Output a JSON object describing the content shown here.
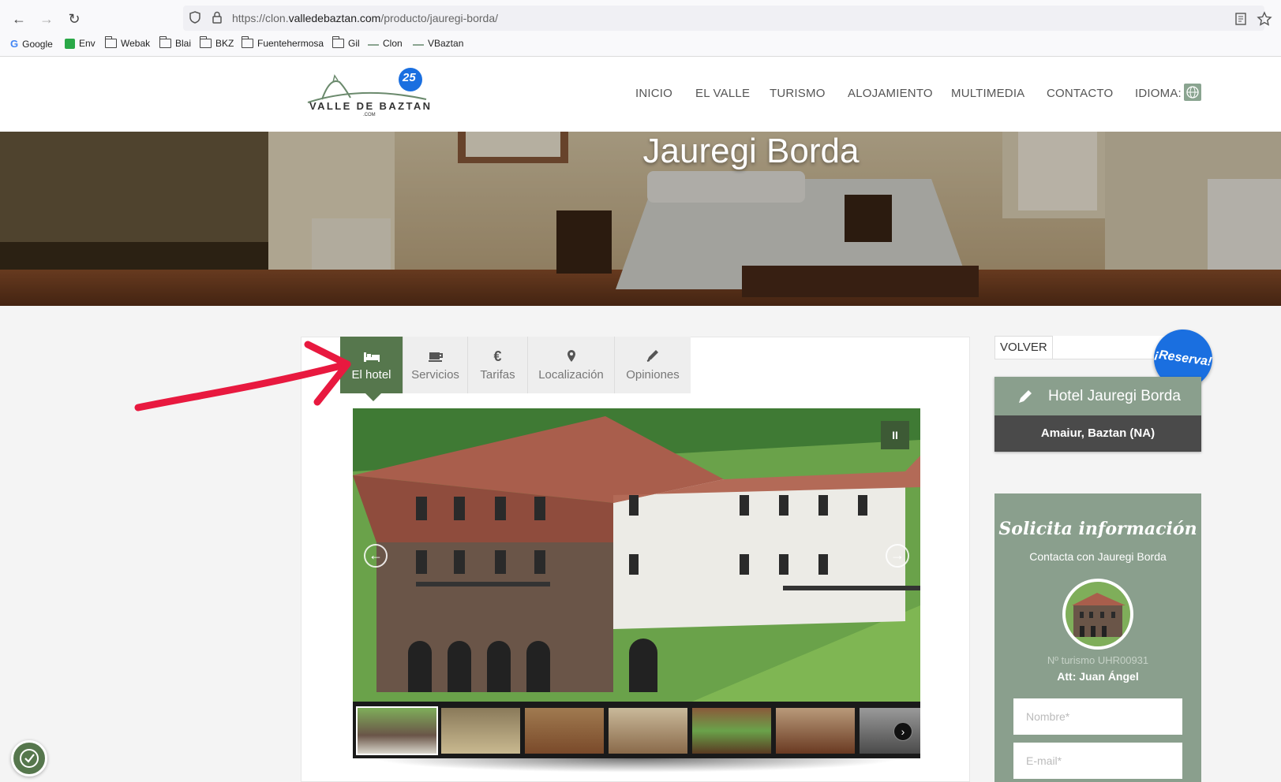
{
  "browser": {
    "url_prefix": "https://clon.",
    "url_domain": "valledebaztan.com",
    "url_path": "/producto/jauregi-borda/",
    "bookmarks": [
      {
        "label": "Google",
        "icon": "google-icon"
      },
      {
        "label": "Env",
        "icon": "env-icon"
      },
      {
        "label": "Webak",
        "icon": "folder-icon"
      },
      {
        "label": "Blai",
        "icon": "folder-icon"
      },
      {
        "label": "BKZ",
        "icon": "folder-icon"
      },
      {
        "label": "Fuentehermosa",
        "icon": "folder-icon"
      },
      {
        "label": "Gil",
        "icon": "folder-icon"
      },
      {
        "label": "Clon",
        "icon": "site-icon"
      },
      {
        "label": "VBaztan",
        "icon": "site-icon"
      }
    ]
  },
  "site": {
    "logo_text": "VALLE DE BAZTAN",
    "logo_sub": ".COM",
    "logo_badge": "25",
    "nav": [
      "INICIO",
      "EL VALLE",
      "TURISMO",
      "ALOJAMIENTO",
      "MULTIMEDIA",
      "CONTACTO",
      "IDIOMA:"
    ]
  },
  "hero": {
    "title": "Jauregi Borda"
  },
  "tabs": [
    {
      "label": "El hotel",
      "icon": "bed-icon",
      "active": true
    },
    {
      "label": "Servicios",
      "icon": "coffee-icon",
      "active": false
    },
    {
      "label": "Tarifas",
      "icon": "euro-icon",
      "active": false
    },
    {
      "label": "Localización",
      "icon": "map-marker-icon",
      "active": false
    },
    {
      "label": "Opiniones",
      "icon": "pencil-icon",
      "active": false
    }
  ],
  "sidebar": {
    "volver": "VOLVER",
    "reserva": "¡Reserva!",
    "hotel_name": "Hotel Jauregi Borda",
    "location": "Amaiur, Baztan (NA)",
    "info_title": "Solicita información",
    "info_sub": "Contacta con Jauregi Borda",
    "turismo": "Nº turismo UHR00931",
    "att": "Att: Juan Ángel",
    "name_placeholder": "Nombre*",
    "email_placeholder": "E-mail*"
  },
  "colors": {
    "brand_green": "#56774d",
    "sidebar_green": "#8a9f8d",
    "reserva_blue": "#1a6fe0",
    "annotation_red": "#e8193f"
  }
}
